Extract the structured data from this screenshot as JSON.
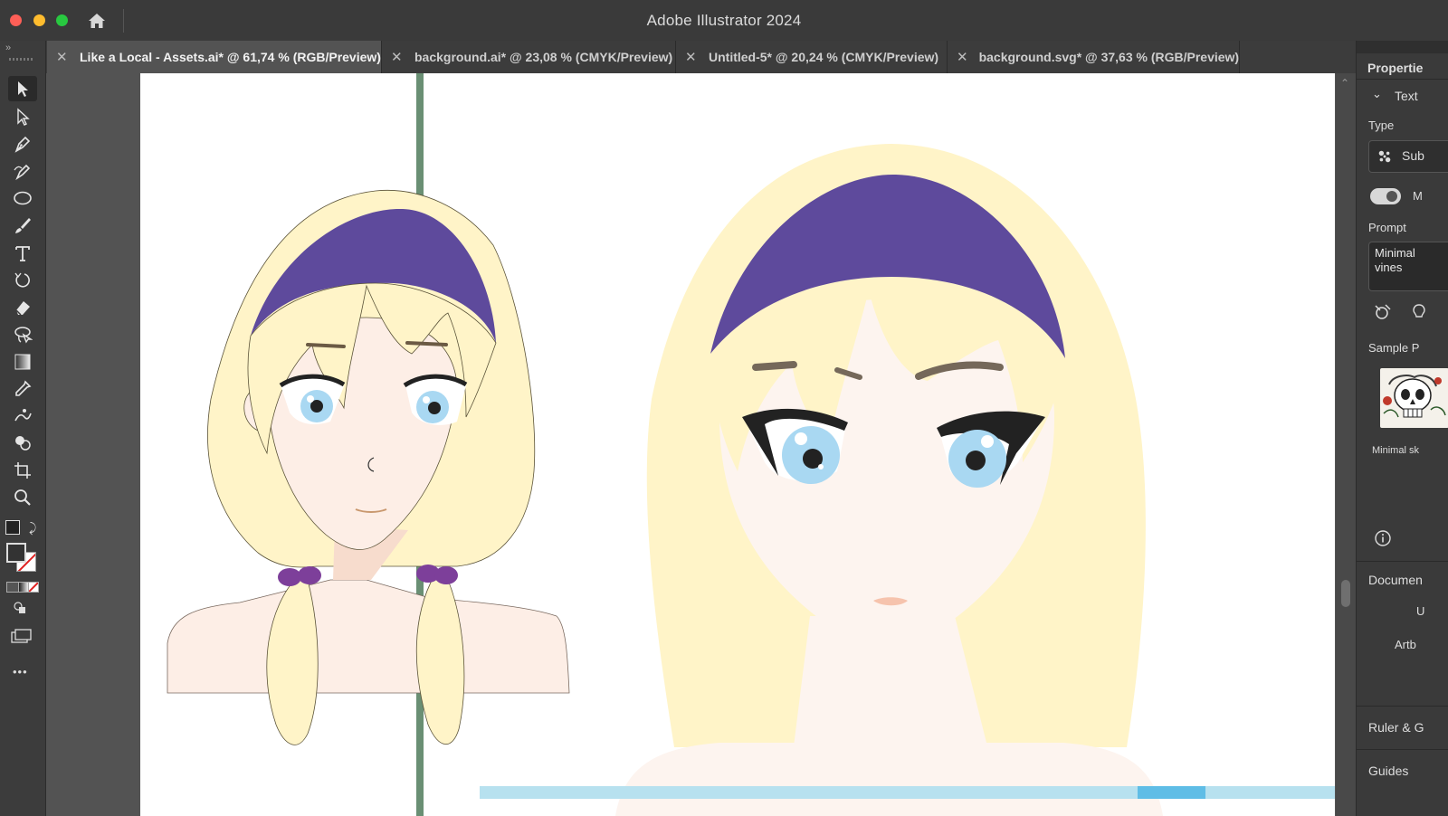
{
  "window": {
    "title": "Adobe Illustrator 2024"
  },
  "tabs": [
    {
      "label": "Like a Local - Assets.ai* @ 61,74 % (RGB/Preview)",
      "active": true
    },
    {
      "label": "background.ai* @ 23,08 % (CMYK/Preview)",
      "active": false
    },
    {
      "label": "Untitled-5* @ 20,24 % (CMYK/Preview)",
      "active": false
    },
    {
      "label": "background.svg* @ 37,63 % (RGB/Preview)",
      "active": false
    }
  ],
  "toolbar": {
    "collapse_label": "»",
    "tools": [
      "selection-tool",
      "direct-selection-tool",
      "pen-tool",
      "curvature-tool",
      "ellipse-tool",
      "paintbrush-tool",
      "type-tool",
      "rotate-tool",
      "eraser-tool",
      "lasso-tool",
      "gradient-tool",
      "eyedropper-tool",
      "puppet-warp-tool",
      "shape-builder-tool",
      "artboard-tool",
      "zoom-tool"
    ],
    "more_label": "•••"
  },
  "properties_panel": {
    "title": "Propertie",
    "section": "Text",
    "type_label": "Type",
    "type_value": "Sub",
    "toggle_label": "M",
    "prompt_label": "Prompt",
    "prompt_value": "Minimal vines",
    "sample_label": "Sample P",
    "sample_caption": "Minimal sk",
    "document_label": "Documen",
    "units_label": "U",
    "artboard_label": "Artb",
    "ruler_label": "Ruler & G",
    "guides_label": "Guides"
  },
  "colors": {
    "hair": "#fff4c8",
    "headband": "#5e4a9c",
    "skin": "#fdeee6",
    "eyes": "#a9d8f2",
    "scrunchie": "#7d3f9a",
    "guide_green": "#6a8f74"
  }
}
